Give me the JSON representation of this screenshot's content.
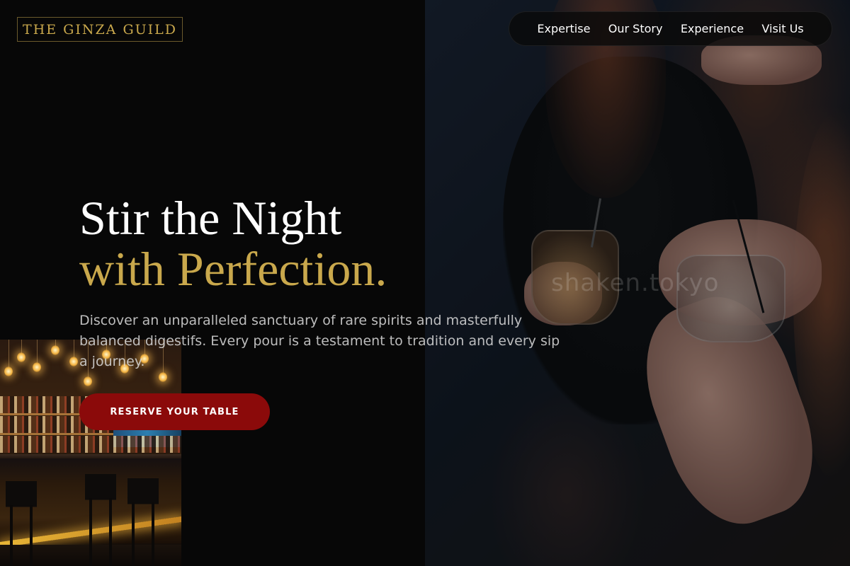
{
  "brand": {
    "logo_text": "THE GINZA GUILD",
    "accent_color": "#c9a84c",
    "cta_color": "#8b0a0a"
  },
  "nav": {
    "items": [
      {
        "label": "Expertise"
      },
      {
        "label": "Our Story"
      },
      {
        "label": "Experience"
      },
      {
        "label": "Visit Us"
      }
    ]
  },
  "hero": {
    "title_line1": "Stir the Night",
    "title_line2": "with Perfection.",
    "description": "Discover an unparalleled sanctuary of rare spirits and masterfully balanced digestifs. Every pour is a testament to tradition and every sip a journey.",
    "cta_label": "RESERVE YOUR TABLE",
    "photo_watermark": "shaken.tokyo"
  }
}
